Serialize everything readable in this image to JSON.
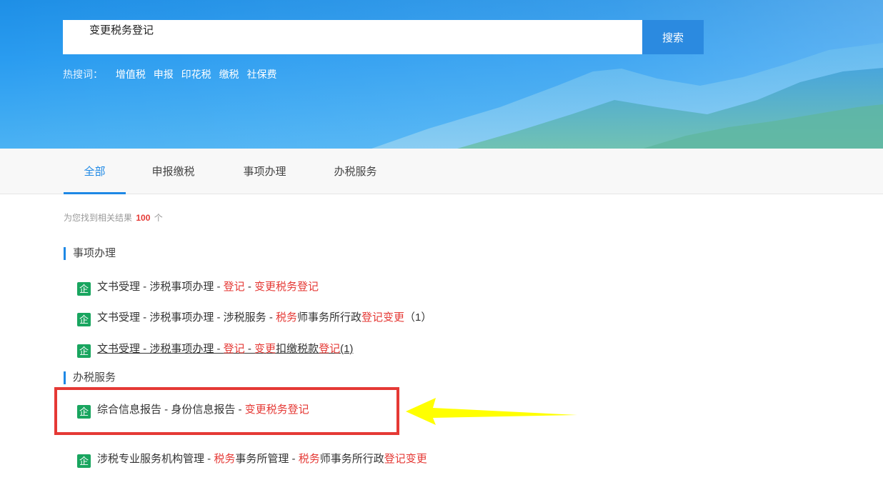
{
  "search": {
    "value": "变更税务登记",
    "button_label": "搜索"
  },
  "hot_search": {
    "label": "热搜词：",
    "terms": [
      "增值税",
      "申报",
      "印花税",
      "缴税",
      "社保费"
    ]
  },
  "tabs": [
    "全部",
    "申报缴税",
    "事项办理",
    "办税服务"
  ],
  "results_count": {
    "prefix": "为您找到相关结果",
    "count": "100",
    "suffix": "个"
  },
  "sections": {
    "matters": {
      "title": "事项办理",
      "items": [
        {
          "parts": [
            "文书受理 - 涉税事项办理 - ",
            "登记",
            " - ",
            "变更税务登记"
          ]
        },
        {
          "parts": [
            "文书受理 - 涉税事项办理 - 涉税服务 - ",
            "税务",
            "师事务所行政",
            "登记变更",
            "（1）"
          ]
        },
        {
          "parts": [
            "文书受理 - 涉税事项办理 - ",
            "登记",
            " - ",
            "变更",
            "扣缴税款",
            "登记",
            "(1)"
          ]
        }
      ]
    },
    "services": {
      "title": "办税服务",
      "items": [
        {
          "parts": [
            "综合信息报告 - 身份信息报告 - ",
            "变更税务登记"
          ]
        },
        {
          "parts": [
            "涉税专业服务机构管理 - ",
            "税务",
            "事务所管理 - ",
            "税务",
            "师事务所行政",
            "登记变更"
          ]
        }
      ]
    }
  },
  "icon_glyph": "企",
  "colors": {
    "accent": "#1e88e5",
    "highlight": "#e53935",
    "icon_bg": "#19a55f",
    "annotation_box": "#e53935",
    "annotation_arrow": "#ffff00"
  }
}
